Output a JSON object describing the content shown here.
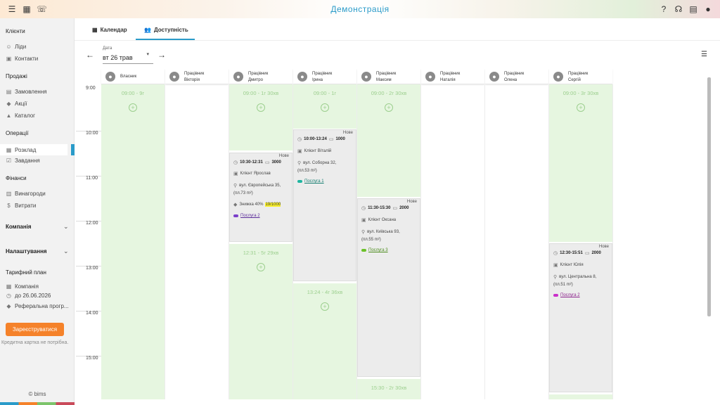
{
  "topbar": {
    "title": "Демонстрація"
  },
  "sidebar": {
    "sections": {
      "clients": "Клієнти",
      "sales": "Продажі",
      "operations": "Операції",
      "finance": "Фінанси",
      "company": "Компанія",
      "settings": "Налаштування",
      "plan": "Тарифний план"
    },
    "items": {
      "leads": "Ліди",
      "contacts": "Контакти",
      "orders": "Замовлення",
      "promos": "Акції",
      "catalog": "Каталог",
      "schedule": "Розклад",
      "tasks": "Завдання",
      "rewards": "Винагороди",
      "expenses": "Витрати",
      "plan_company": "Компанія",
      "plan_until": "до 26.06.2026",
      "referral": "Реферальна прогр..."
    },
    "register": "Зареєструватися",
    "note": "Кредитна картка не потрібна.",
    "copyright": "© bims"
  },
  "tabs": {
    "calendar": "Календар",
    "availability": "Доступність"
  },
  "date": {
    "label": "Дата",
    "value": "вт 26 трав"
  },
  "times": [
    "9:00",
    "10:00",
    "11:00",
    "12:00",
    "13:00",
    "14:00",
    "15:00"
  ],
  "columns": [
    {
      "role": "Власник",
      "name": ""
    },
    {
      "role": "Працівник",
      "name": "Вікторія"
    },
    {
      "role": "Працівник",
      "name": "Дмитро"
    },
    {
      "role": "Працівник",
      "name": "Ірина"
    },
    {
      "role": "Працівник",
      "name": "Максим"
    },
    {
      "role": "Працівник",
      "name": "Наталія"
    },
    {
      "role": "Працівник",
      "name": "Олена"
    },
    {
      "role": "Працівник",
      "name": "Сергій"
    }
  ],
  "free": {
    "owner": "09:00 - 9г",
    "dmytro1": "09:00 - 1г 30хв",
    "dmytro2": "12:31 - 5г 29хв",
    "iryna1": "09:00 - 1г",
    "iryna2": "13:24 - 4г 36хв",
    "maksym1": "09:00 - 2г 30хв",
    "maksym2": "15:30 - 2г 30хв",
    "serhii1": "09:00 - 3г 30хв"
  },
  "appointments": {
    "dmytro": {
      "status": "Нове",
      "time": "10:30-12:31",
      "price": "3000",
      "client": "Клієнт Ярослав",
      "address": "вул. Європейська 35,",
      "area": "(пл.73 m²)",
      "discount": "Знижка 40%",
      "discount_val": "19/1000",
      "service": "Послуга 2",
      "color": "#7b3fc9"
    },
    "iryna": {
      "status": "Нове",
      "time": "10:00-13:24",
      "price": "1000",
      "client": "Клієнт Віталій",
      "address": "вул. Соборна 32,",
      "area": "(пл.53 m²)",
      "service": "Послуга 1",
      "color": "#1fb5a0"
    },
    "maksym": {
      "status": "Нове",
      "time": "11:30-15:30",
      "price": "2000",
      "client": "Клієнт Оксана",
      "address": "вул. Київська 93,",
      "area": "(пл.55 m²)",
      "service": "Послуга 3",
      "color": "#6cc12a"
    },
    "serhii": {
      "status": "Нове",
      "time": "12:30-15:51",
      "price": "2000",
      "client": "Клієнт Юлія",
      "address": "вул. Центральна 8,",
      "area": "(пл.51 m²)",
      "service": "Послуга 2",
      "color": "#c92fc9"
    }
  }
}
